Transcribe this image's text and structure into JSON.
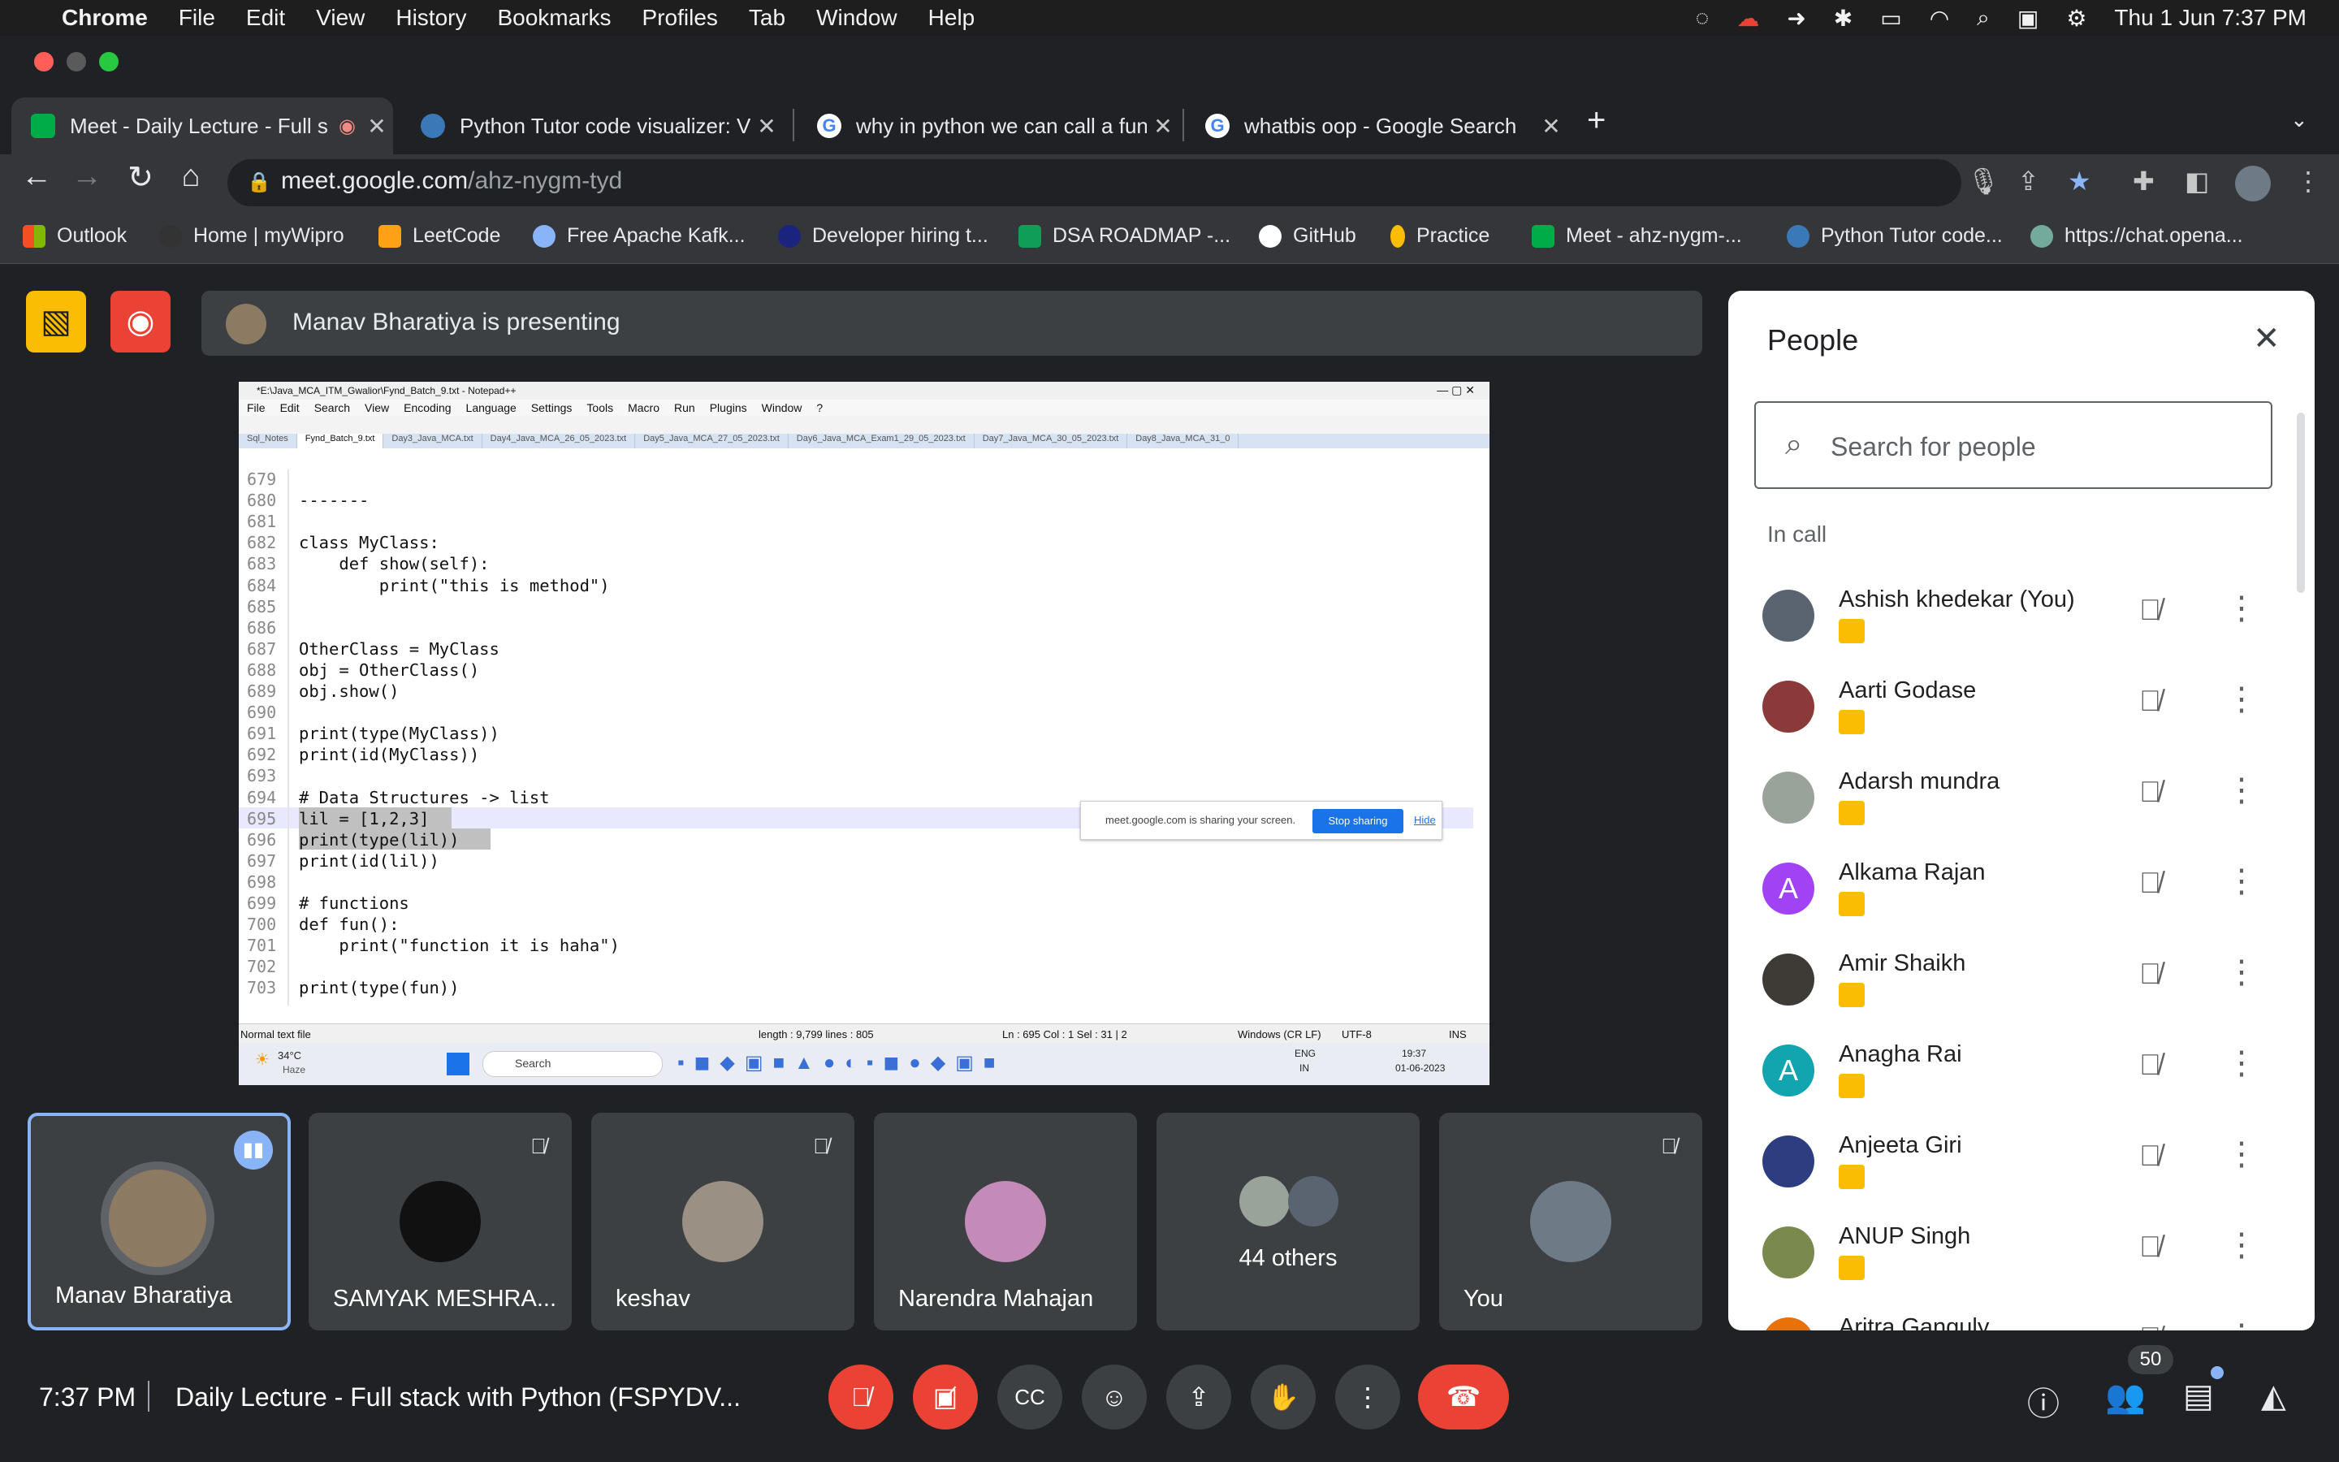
{
  "menubar": {
    "app": "Chrome",
    "items": [
      "File",
      "Edit",
      "View",
      "History",
      "Bookmarks",
      "Profiles",
      "Tab",
      "Window",
      "Help"
    ],
    "clock": "Thu 1 Jun  7:37 PM"
  },
  "tabs": [
    {
      "title": "Meet - Daily Lecture - Full s",
      "active": true
    },
    {
      "title": "Python Tutor code visualizer: V"
    },
    {
      "title": "why in python we can call a fun"
    },
    {
      "title": "whatbis oop - Google Search"
    }
  ],
  "new_tab": "+",
  "omnibox": {
    "host": "meet.google.com",
    "path": "/ahz-nygm-tyd"
  },
  "bookmarks": [
    "Outlook",
    "Home | myWipro",
    "LeetCode",
    "Free Apache Kafk...",
    "Developer hiring t...",
    "DSA ROADMAP -...",
    "GitHub",
    "Practice",
    "Meet - ahz-nygm-...",
    "Python Tutor code...",
    "https://chat.opena..."
  ],
  "presenting": "Manav Bharatiya is presenting",
  "notepad": {
    "title": "*E:\\Java_MCA_ITM_Gwalior\\Fynd_Batch_9.txt - Notepad++",
    "menu": [
      "File",
      "Edit",
      "Search",
      "View",
      "Encoding",
      "Language",
      "Settings",
      "Tools",
      "Macro",
      "Run",
      "Plugins",
      "Window",
      "?"
    ],
    "tabs": [
      "Sql_Notes",
      "Fynd_Batch_9.txt",
      "Day3_Java_MCA.txt",
      "Day4_Java_MCA_26_05_2023.txt",
      "Day5_Java_MCA_27_05_2023.txt",
      "Day6_Java_MCA_Exam1_29_05_2023.txt",
      "Day7_Java_MCA_30_05_2023.txt",
      "Day8_Java_MCA_31_0"
    ],
    "lines": [
      {
        "n": "679",
        "c": ""
      },
      {
        "n": "680",
        "c": "-------"
      },
      {
        "n": "681",
        "c": ""
      },
      {
        "n": "682",
        "c": "class MyClass:"
      },
      {
        "n": "683",
        "c": "    def show(self):"
      },
      {
        "n": "684",
        "c": "        print(\"this is method\")"
      },
      {
        "n": "685",
        "c": ""
      },
      {
        "n": "686",
        "c": ""
      },
      {
        "n": "687",
        "c": "OtherClass = MyClass"
      },
      {
        "n": "688",
        "c": "obj = OtherClass()"
      },
      {
        "n": "689",
        "c": "obj.show()"
      },
      {
        "n": "690",
        "c": ""
      },
      {
        "n": "691",
        "c": "print(type(MyClass))"
      },
      {
        "n": "692",
        "c": "print(id(MyClass))"
      },
      {
        "n": "693",
        "c": ""
      },
      {
        "n": "694",
        "c": "# Data Structures -> list"
      },
      {
        "n": "695",
        "c": "lil = [1,2,3]"
      },
      {
        "n": "696",
        "c": "print(type(lil))"
      },
      {
        "n": "697",
        "c": "print(id(lil))"
      },
      {
        "n": "698",
        "c": ""
      },
      {
        "n": "699",
        "c": "# functions"
      },
      {
        "n": "700",
        "c": "def fun():"
      },
      {
        "n": "701",
        "c": "    print(\"function it is haha\")"
      },
      {
        "n": "702",
        "c": ""
      },
      {
        "n": "703",
        "c": "print(type(fun))"
      }
    ],
    "share_notice": "meet.google.com is sharing your screen.",
    "stop_sharing": "Stop sharing",
    "hide": "Hide",
    "status": {
      "type": "Normal text file",
      "length": "length : 9,799    lines : 805",
      "pos": "Ln : 695    Col : 1    Sel : 31 | 2",
      "eol": "Windows (CR LF)",
      "enc": "UTF-8",
      "mode": "INS"
    },
    "taskbar": {
      "temp": "34°C",
      "weather": "Haze",
      "search": "Search",
      "lang": "ENG",
      "region": "IN",
      "time": "19:37",
      "date": "01-06-2023"
    }
  },
  "tiles": [
    {
      "name": "Manav Bharatiya",
      "color": "#8d7a62"
    },
    {
      "name": "SAMYAK MESHRA...",
      "color": "#111111"
    },
    {
      "name": "keshav",
      "color": "#9a9184"
    },
    {
      "name": "Narendra Mahajan",
      "color": "#c48ab8"
    },
    {
      "name": "44 others",
      "color": "#7e8a96"
    },
    {
      "name": "You",
      "color": "#6e7b86"
    }
  ],
  "people": {
    "title": "People",
    "search_placeholder": "Search for people",
    "section": "In call",
    "list": [
      {
        "name": "Ashish khedekar (You)",
        "initial": "",
        "color": "#5a6470"
      },
      {
        "name": "Aarti Godase",
        "initial": "",
        "color": "#8b3a3a"
      },
      {
        "name": "Adarsh mundra",
        "initial": "",
        "color": "#9aa39a"
      },
      {
        "name": "Alkama Rajan",
        "initial": "A",
        "color": "#a142f4"
      },
      {
        "name": "Amir Shaikh",
        "initial": "",
        "color": "#3e3a36"
      },
      {
        "name": "Anagha Rai",
        "initial": "A",
        "color": "#12a4af"
      },
      {
        "name": "Anjeeta Giri",
        "initial": "",
        "color": "#2c3e80"
      },
      {
        "name": "ANUP Singh",
        "initial": "",
        "color": "#7a8a4e"
      },
      {
        "name": "Aritra Ganguly",
        "initial": "A",
        "color": "#e8710a"
      }
    ]
  },
  "bottom": {
    "time": "7:37 PM",
    "meeting": "Daily Lecture - Full stack with Python (FSPYDV...",
    "participants_count": "50"
  },
  "colors": {
    "accent": "#8ab4f8",
    "danger": "#ea4335",
    "warn": "#fbbc04",
    "bg": "#202124"
  }
}
